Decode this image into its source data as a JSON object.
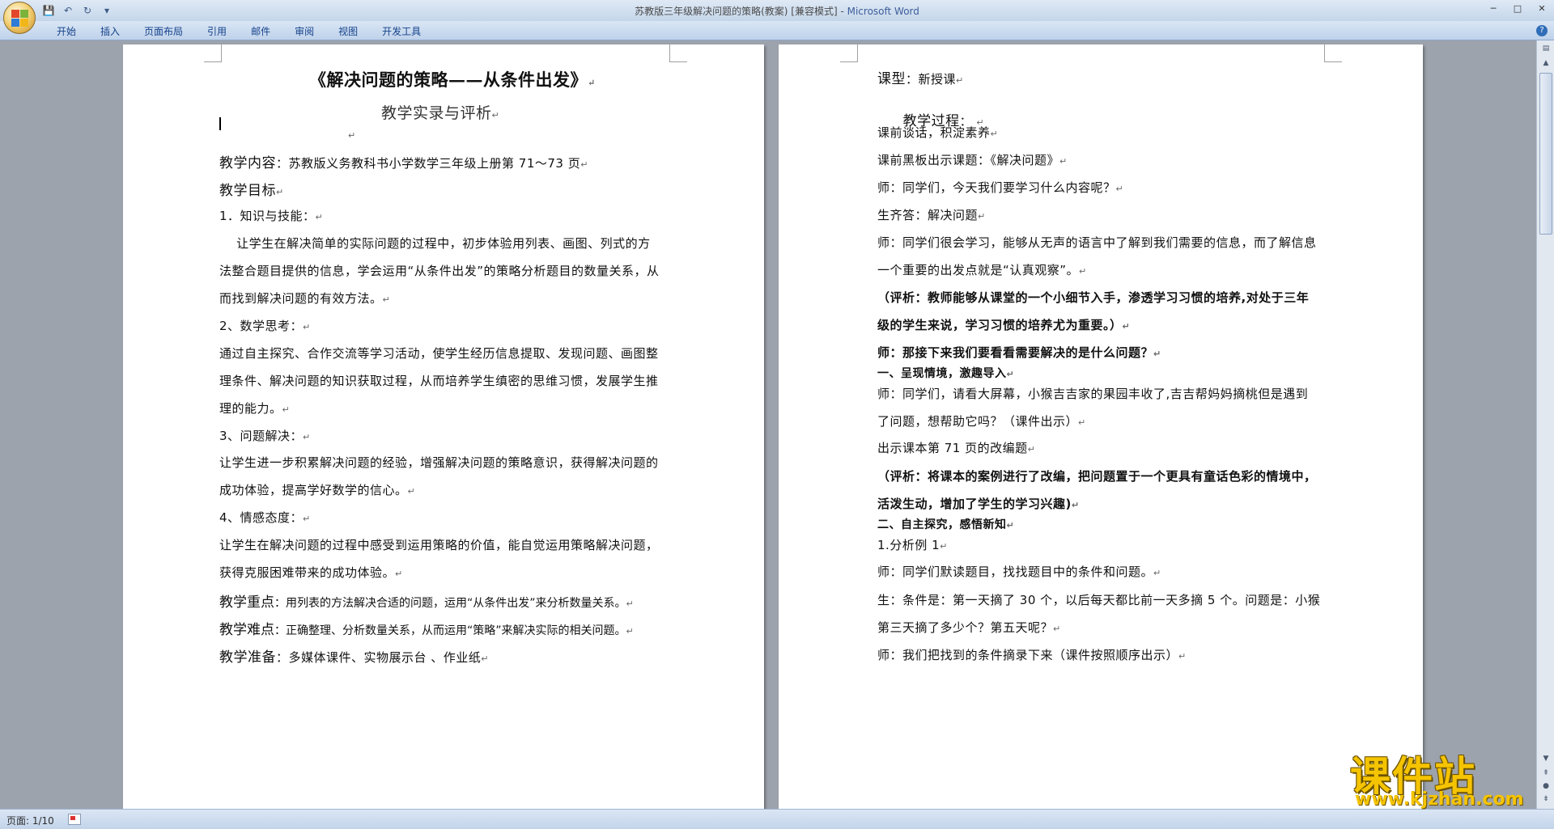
{
  "window": {
    "title": "苏教版三年级解决问题的策略(教案) [兼容模式]",
    "title_sep": " - ",
    "app_name": "Microsoft Word",
    "controls": [
      "─",
      "□",
      "✕"
    ]
  },
  "quick_access": {
    "save": "💾",
    "undo": "↶",
    "redo": "↻",
    "customize": "▾"
  },
  "ribbon": {
    "tabs": [
      "开始",
      "插入",
      "页面布局",
      "引用",
      "邮件",
      "审阅",
      "视图",
      "开发工具"
    ],
    "help": "?"
  },
  "page1": {
    "lines": [
      {
        "text": "《解决问题的策略——从条件出发》",
        "mark": "↵"
      },
      {
        "text": "教学实录与评析",
        "mark": "↵"
      },
      {
        "text": "",
        "mark": "↵"
      },
      {
        "label": "教学内容",
        "text": "：苏教版义务教科书小学数学三年级上册第 71～73 页",
        "mark": "↵"
      },
      {
        "label": "教学目标",
        "text": "",
        "mark": "↵"
      },
      {
        "text": "1．知识与技能：",
        "mark": "↵"
      },
      {
        "text": "    让学生在解决简单的实际问题的过程中，初步体验用列表、画图、列式的方",
        "mark": ""
      },
      {
        "text": "法整合题目提供的信息，学会运用“从条件出发”的策略分析题目的数量关系，从",
        "mark": ""
      },
      {
        "text": "而找到解决问题的有效方法。",
        "mark": "↵"
      },
      {
        "text": "2、数学思考：",
        "mark": "↵"
      },
      {
        "text": "通过自主探究、合作交流等学习活动，使学生经历信息提取、发现问题、画图整",
        "mark": ""
      },
      {
        "text": "理条件、解决问题的知识获取过程，从而培养学生缜密的思维习惯，发展学生推",
        "mark": ""
      },
      {
        "text": "理的能力。",
        "mark": "↵"
      },
      {
        "text": "3、问题解决：",
        "mark": "↵"
      },
      {
        "text": "让学生进一步积累解决问题的经验，增强解决问题的策略意识，获得解决问题的",
        "mark": ""
      },
      {
        "text": "成功体验，提高学好数学的信心。",
        "mark": "↵"
      },
      {
        "text": "4、情感态度：",
        "mark": "↵"
      },
      {
        "text": "让学生在解决问题的过程中感受到运用策略的价值，能自觉运用策略解决问题，",
        "mark": ""
      },
      {
        "text": "获得克服困难带来的成功体验。",
        "mark": "↵"
      },
      {
        "label": "教学重点",
        "text": "：用列表的方法解决合适的问题，运用“从条件出发”来分析数量关系。",
        "mark": "↵"
      },
      {
        "label": "教学难点",
        "text": "：正确整理、分析数量关系，从而运用“策略”来解决实际的相关问题。",
        "mark": "↵"
      },
      {
        "label": "教学准备",
        "text": "：多媒体课件、实物展示台 、作业纸",
        "mark": "↵"
      }
    ]
  },
  "page2": {
    "lines": [
      {
        "label": "课型",
        "text": "：新授课",
        "mark": "↵"
      },
      {
        "label": "教学过程",
        "text": "： ",
        "mark": "↵"
      },
      {
        "text": "课前谈话，积淀素养",
        "mark": "↵"
      },
      {
        "text": "课前黑板出示课题：《解决问题》",
        "mark": "↵"
      },
      {
        "text": "师：同学们，今天我们要学习什么内容呢？",
        "mark": "↵"
      },
      {
        "text": "生齐答：解决问题",
        "mark": "↵"
      },
      {
        "text": "师：同学们很会学习，能够从无声的语言中了解到我们需要的信息，而了解信息",
        "mark": ""
      },
      {
        "text": "一个重要的出发点就是“认真观察”。",
        "mark": "↵"
      },
      {
        "text": "（评析：教师能够从课堂的一个小细节入手，渗透学习习惯的培养,对处于三年",
        "mark": "",
        "bold": true
      },
      {
        "text": "级的学生来说，学习习惯的培养尤为重要。）",
        "mark": "↵",
        "bold": true
      },
      {
        "text": "师：那接下来我们要看看需要解决的是什么问题？",
        "mark": "↵",
        "bold": true
      },
      {
        "text": "一、呈现情境，激趣导入",
        "mark": "↵",
        "bold": true
      },
      {
        "text": "师：同学们，请看大屏幕，小猴吉吉家的果园丰收了,吉吉帮妈妈摘桃但是遇到",
        "mark": ""
      },
      {
        "text": "了问题，想帮助它吗？（课件出示）",
        "mark": "↵"
      },
      {
        "text": "出示课本第 71 页的改编题",
        "mark": "↵"
      },
      {
        "text": "（评析：将课本的案例进行了改编，把问题置于一个更具有童话色彩的情境中，",
        "mark": "",
        "bold": true
      },
      {
        "text": "活泼生动，增加了学生的学习兴趣)",
        "mark": "↵",
        "bold": true
      },
      {
        "text": "二、自主探究，感悟新知",
        "mark": "↵",
        "bold": true
      },
      {
        "text": "1.分析例 1",
        "mark": "↵"
      },
      {
        "text": "师：同学们默读题目，找找题目中的条件和问题。",
        "mark": "↵"
      },
      {
        "text": "生：条件是：第一天摘了 30 个，以后每天都比前一天多摘 5 个。问题是：小猴",
        "mark": ""
      },
      {
        "text": "第三天摘了多少个？第五天呢？",
        "mark": "↵"
      },
      {
        "text": "师：我们把找到的条件摘录下来（课件按照顺序出示）",
        "mark": "↵"
      }
    ]
  },
  "statusbar": {
    "page": "页面: 1/10"
  },
  "watermark": {
    "cn": "课件站",
    "url": "www.kjzhan.com"
  }
}
